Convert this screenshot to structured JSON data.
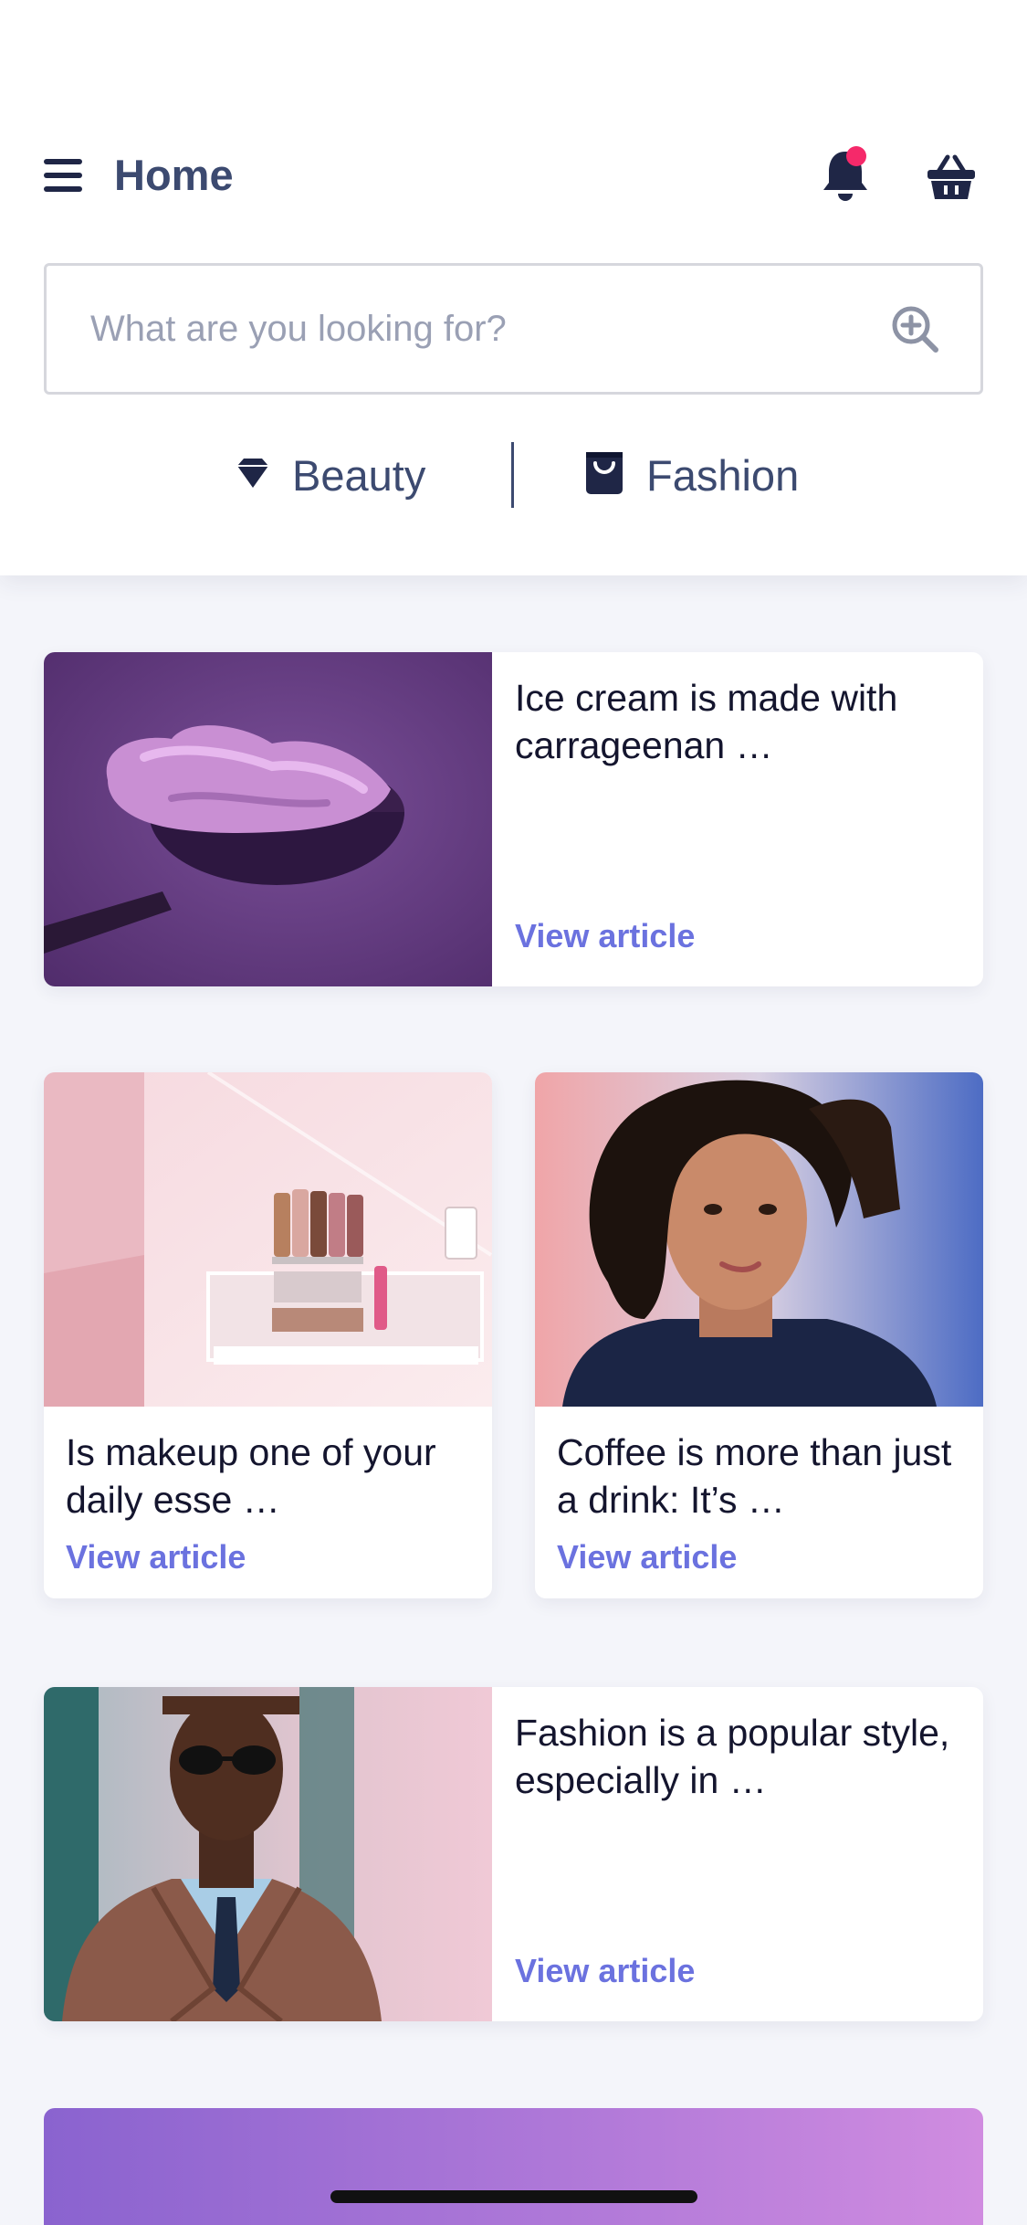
{
  "header": {
    "title": "Home",
    "menu_icon": "hamburger-menu-icon",
    "notification_icon": "bell-icon",
    "basket_icon": "basket-icon",
    "notification_dot_color": "#f5296a"
  },
  "search": {
    "placeholder": "What are you looking for?",
    "value": "",
    "icon": "zoom-in-search-icon"
  },
  "categories": [
    {
      "label": "Beauty",
      "icon": "diamond-icon"
    },
    {
      "label": "Fashion",
      "icon": "shopping-bag-icon"
    }
  ],
  "articles": [
    {
      "title": "Ice cream is made with carrageenan …",
      "link": "View article",
      "image": "purple-ice-cream-scoop-photo"
    },
    {
      "title": "Is makeup one of your daily esse …",
      "link": "View article",
      "image": "makeup-display-shelf-photo"
    },
    {
      "title": "Coffee is more than just a drink: It’s …",
      "link": "View article",
      "image": "curly-haired-woman-portrait-photo"
    },
    {
      "title": "Fashion is a popular style, especially in …",
      "link": "View article",
      "image": "man-in-leather-jacket-photo"
    }
  ],
  "colors": {
    "accent": "#6b72df",
    "header_text": "#3c4a70",
    "background": "#f4f5fa"
  }
}
